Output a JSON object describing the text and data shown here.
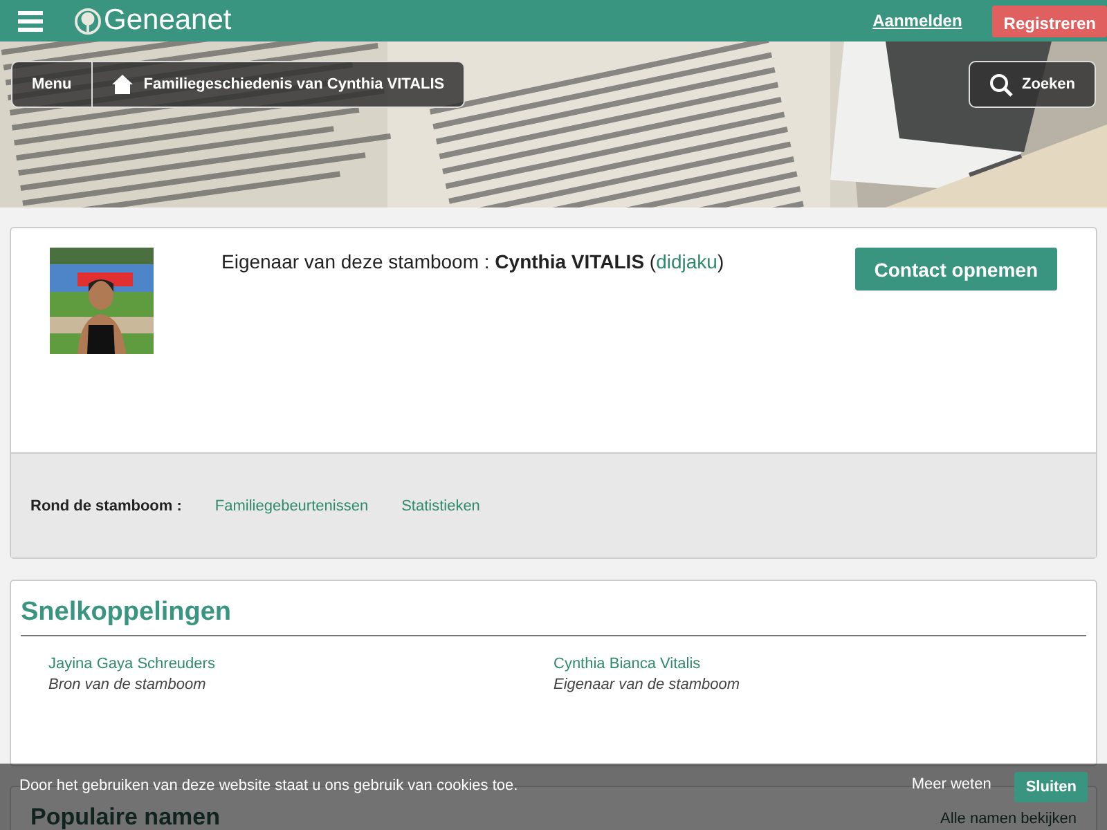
{
  "header": {
    "logo": "Geneanet",
    "login": "Aanmelden",
    "register": "Registreren"
  },
  "banner": {
    "kind": "picture",
    "menu": "Menu",
    "breadcrumb": "Familiegeschiedenis van Cynthia VITALIS",
    "search": "Zoeken"
  },
  "owner": {
    "label": "Eigenaar van deze stamboom : ",
    "name": "Cynthia VITALIS",
    "paren_open": "(",
    "username": "didjaku",
    "paren_close": ")",
    "contact": "Contact opnemen"
  },
  "around": {
    "label": "Rond de stamboom :",
    "links": [
      "Familiegebeurtenissen",
      "Statistieken"
    ]
  },
  "quicklinks": {
    "title": "Snelkoppelingen",
    "items": [
      {
        "name": "Jayina Gaya Schreuders",
        "role": "Bron van de stamboom"
      },
      {
        "name": "Cynthia Bianca Vitalis",
        "role": "Eigenaar van de stamboom"
      }
    ]
  },
  "popular": {
    "title": "Populaire namen",
    "link": "Alle namen bekijken"
  },
  "cookie": {
    "text": "Door het gebruiken van deze website staat u ons gebruik van cookies toe.",
    "more": "Meer weten",
    "close": "Sluiten"
  }
}
